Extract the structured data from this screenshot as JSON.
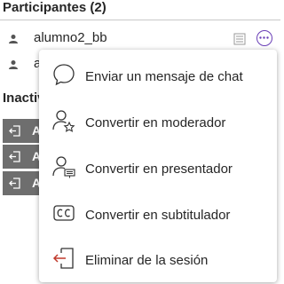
{
  "participants": {
    "title": "Participantes (2)",
    "users": [
      {
        "name": "alumno2_bb"
      },
      {
        "name": "a"
      }
    ]
  },
  "inactive": {
    "title": "Inactiv",
    "rows": [
      {
        "letter": "A"
      },
      {
        "letter": "A"
      },
      {
        "letter": "A"
      }
    ]
  },
  "menu": {
    "items": [
      {
        "label": "Enviar un mensaje de chat",
        "icon": "chat-bubble-icon"
      },
      {
        "label": "Convertir en moderador",
        "icon": "user-star-icon"
      },
      {
        "label": "Convertir en presentador",
        "icon": "user-presenter-icon"
      },
      {
        "label": "Convertir en subtitulador",
        "icon": "closed-captions-icon"
      },
      {
        "label": "Eliminar de la sesión",
        "icon": "remove-exit-icon"
      }
    ]
  },
  "colors": {
    "accent": "#6a3fb7",
    "danger": "#c0392b",
    "inactive_row": "#6e6e6e"
  }
}
